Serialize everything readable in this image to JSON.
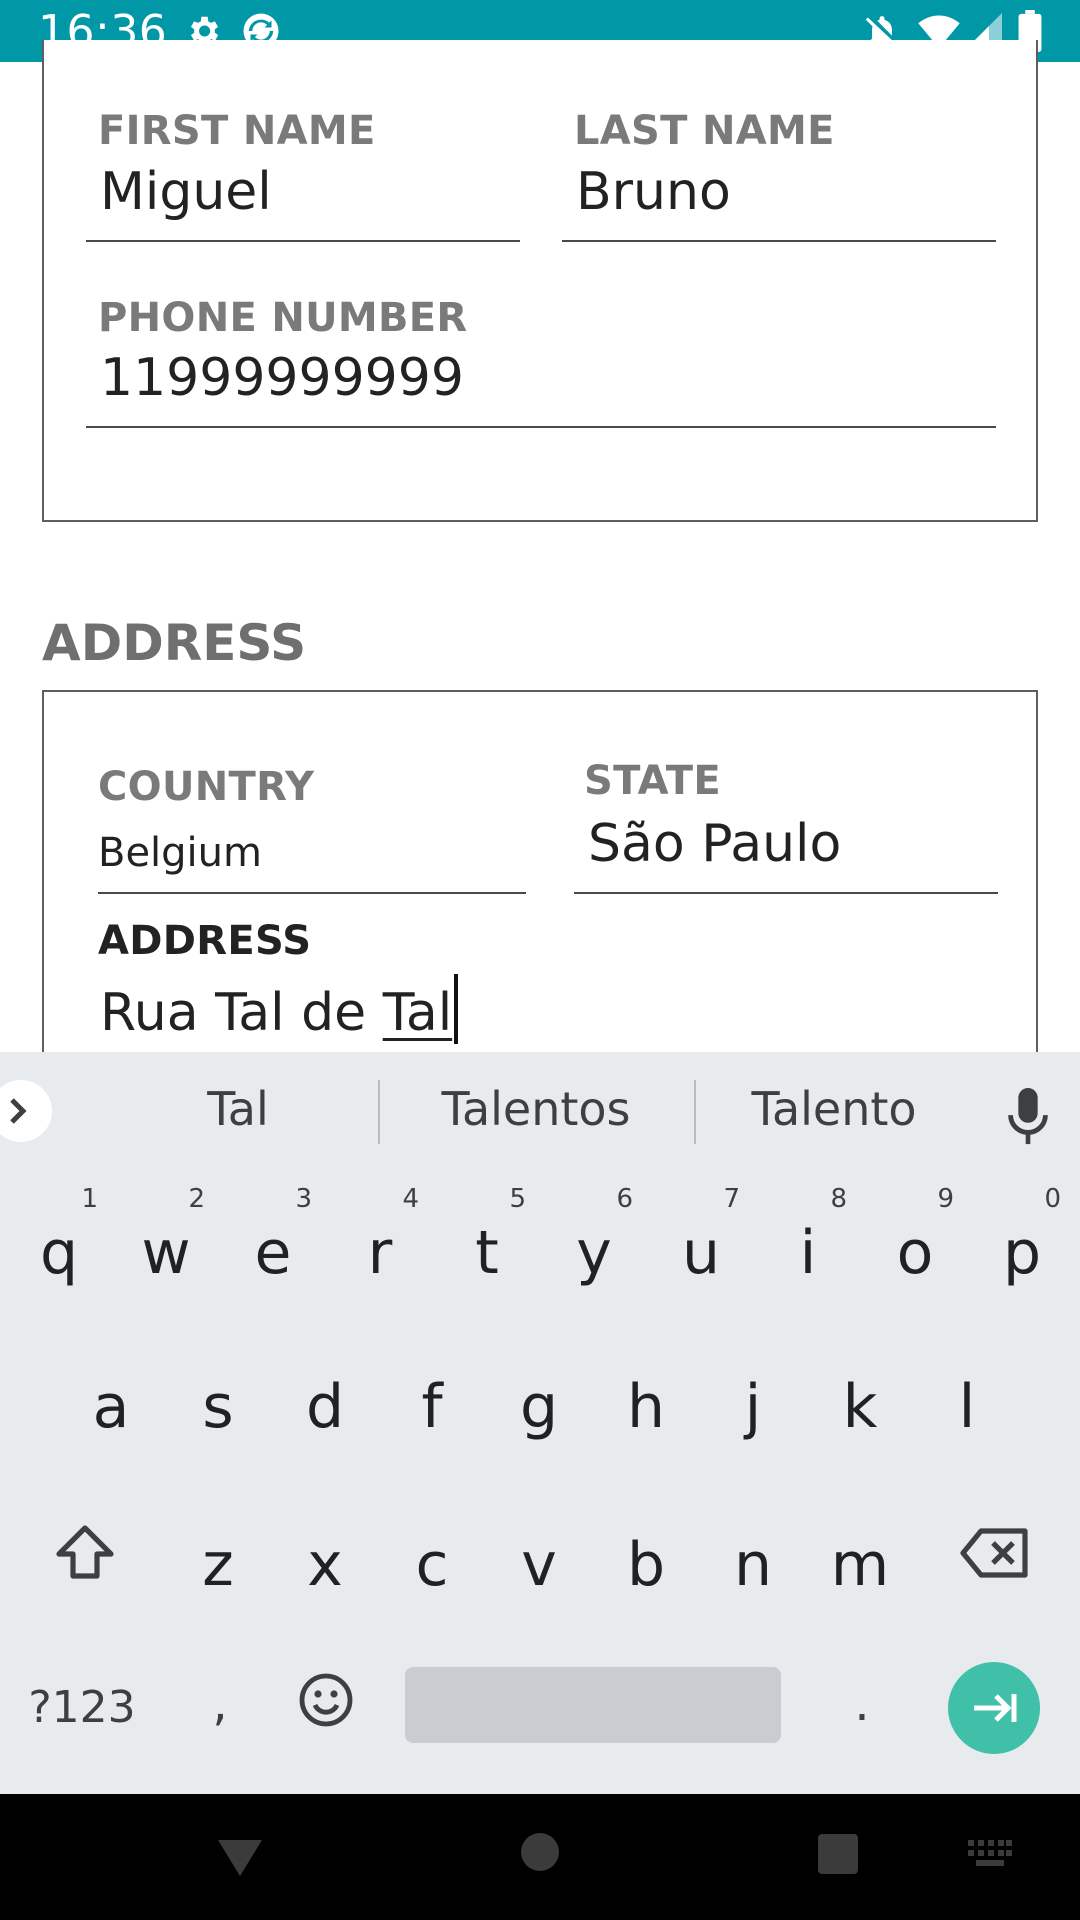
{
  "status_bar": {
    "time": "16:36",
    "icons": [
      "gear-icon",
      "sync-icon",
      "notifications-off-icon",
      "wifi-icon",
      "signal-icon",
      "battery-icon"
    ],
    "color": "#0097a7"
  },
  "personal_card": {
    "first_name": {
      "label": "FIRST NAME",
      "value": "Miguel"
    },
    "last_name": {
      "label": "LAST NAME",
      "value": "Bruno"
    },
    "phone": {
      "label": "PHONE NUMBER",
      "value": "11999999999"
    }
  },
  "address_section": {
    "title": "ADDRESS",
    "country": {
      "label": "COUNTRY",
      "value": "Belgium"
    },
    "state": {
      "label": "STATE",
      "value": "São Paulo"
    },
    "address": {
      "label": "ADDRESS",
      "value_prefix": "Rua Tal de ",
      "value_current_word": "Tal"
    }
  },
  "keyboard": {
    "suggestions": [
      "Tal",
      "Talentos",
      "Talento"
    ],
    "row1": [
      {
        "key": "q",
        "hint": "1"
      },
      {
        "key": "w",
        "hint": "2"
      },
      {
        "key": "e",
        "hint": "3"
      },
      {
        "key": "r",
        "hint": "4"
      },
      {
        "key": "t",
        "hint": "5"
      },
      {
        "key": "y",
        "hint": "6"
      },
      {
        "key": "u",
        "hint": "7"
      },
      {
        "key": "i",
        "hint": "8"
      },
      {
        "key": "o",
        "hint": "9"
      },
      {
        "key": "p",
        "hint": "0"
      }
    ],
    "row2": [
      "a",
      "s",
      "d",
      "f",
      "g",
      "h",
      "j",
      "k",
      "l"
    ],
    "row3": [
      "z",
      "x",
      "c",
      "v",
      "b",
      "n",
      "m"
    ],
    "symbols_label": "?123",
    "comma": ",",
    "period": ".",
    "accent_color": "#40bfa9"
  },
  "nav_bar": {
    "icons": [
      "back-icon",
      "home-icon",
      "recents-icon",
      "keyboard-switch-icon"
    ]
  }
}
